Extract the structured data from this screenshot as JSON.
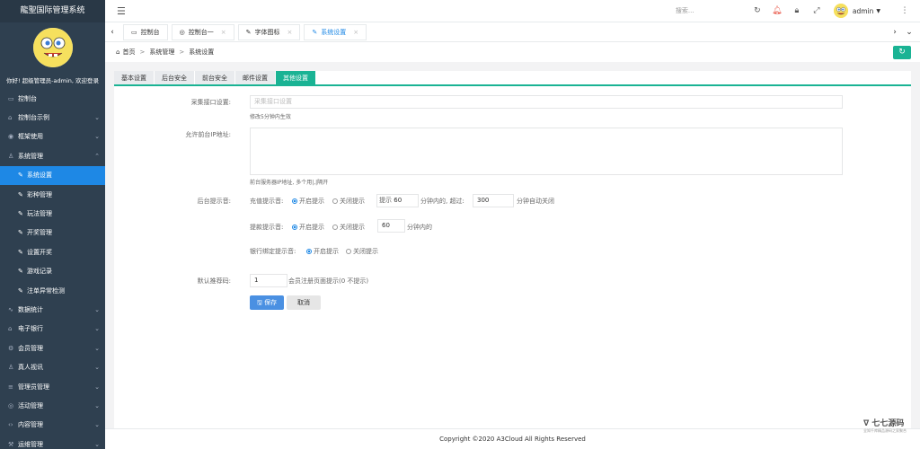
{
  "app": {
    "title": "龍聖国际管理系统",
    "welcome": "你好!  超级管理员-admin, 欢迎登录"
  },
  "sidebar": {
    "items": [
      {
        "label": "控制台",
        "icon": "desktop-icon"
      },
      {
        "label": "控制台示例",
        "icon": "home-icon"
      },
      {
        "label": "框架使用",
        "icon": "eye-icon"
      },
      {
        "label": "系统管理",
        "icon": "user-icon"
      },
      {
        "label": "系统设置",
        "icon": "pen-icon",
        "sub": true,
        "active": true
      },
      {
        "label": "彩种管理",
        "icon": "pen-icon",
        "sub": true
      },
      {
        "label": "玩法管理",
        "icon": "pen-icon",
        "sub": true
      },
      {
        "label": "开奖管理",
        "icon": "pen-icon",
        "sub": true
      },
      {
        "label": "设置开奖",
        "icon": "pen-icon",
        "sub": true
      },
      {
        "label": "游戏记录",
        "icon": "pen-icon",
        "sub": true
      },
      {
        "label": "注单异常检测",
        "icon": "pen-icon",
        "sub": true
      },
      {
        "label": "数据统计",
        "icon": "pulse-icon"
      },
      {
        "label": "电子银行",
        "icon": "bank-icon"
      },
      {
        "label": "会员管理",
        "icon": "gear-icon"
      },
      {
        "label": "真人视讯",
        "icon": "person-icon"
      },
      {
        "label": "管理员管理",
        "icon": "list-icon"
      },
      {
        "label": "活动管理",
        "icon": "circle-icon"
      },
      {
        "label": "内容管理",
        "icon": "code-icon"
      },
      {
        "label": "运维管理",
        "icon": "wrench-icon"
      }
    ]
  },
  "topbar": {
    "search_placeholder": "搜索...",
    "username": "admin"
  },
  "tabs": [
    {
      "label": "控制台",
      "icon": "monitor-icon"
    },
    {
      "label": "控制台一",
      "icon": "circle-icon"
    },
    {
      "label": "字体图标",
      "icon": "pen-icon"
    },
    {
      "label": "系统设置",
      "icon": "pen-icon",
      "active": true
    }
  ],
  "breadcrumb": {
    "home": "首页",
    "level1": "系统管理",
    "level2": "系统设置"
  },
  "content_tabs": [
    "基本设置",
    "后台安全",
    "前台安全",
    "邮件设置",
    "其他设置"
  ],
  "form": {
    "collect_label": "采集接口设置:",
    "collect_placeholder": "采集接口设置",
    "collect_help": "修改5分钟内生效",
    "ip_label": "允许前台IP地址:",
    "ip_help": "前台服务器IP地址, 多个用|,|隔开",
    "alert_label": "后台提示音:",
    "recharge_label": "充值提示音:",
    "on_label": "开启提示",
    "off_label": "关闭提示",
    "recharge_prefix": "提示",
    "recharge_value": "60",
    "recharge_mid": "分钟内的, 超过:",
    "recharge_timeout": "300",
    "recharge_suffix": "分钟自动关闭",
    "withdraw_label": "提款提示音:",
    "withdraw_value": "60",
    "withdraw_suffix": "分钟内的",
    "bank_label": "银行绑定提示音:",
    "ref_label": "默认推荐码:",
    "ref_value": "1",
    "ref_help": "会员注册页面提示(0 不提示)",
    "save_label": "保存",
    "cancel_label": "取消"
  },
  "footer": {
    "copyright": "Copyright ©2020 A3Cloud All Rights Reserved"
  },
  "watermark": {
    "title": "七七源码",
    "subtitle": "全知千库精品源码之家聚合"
  }
}
